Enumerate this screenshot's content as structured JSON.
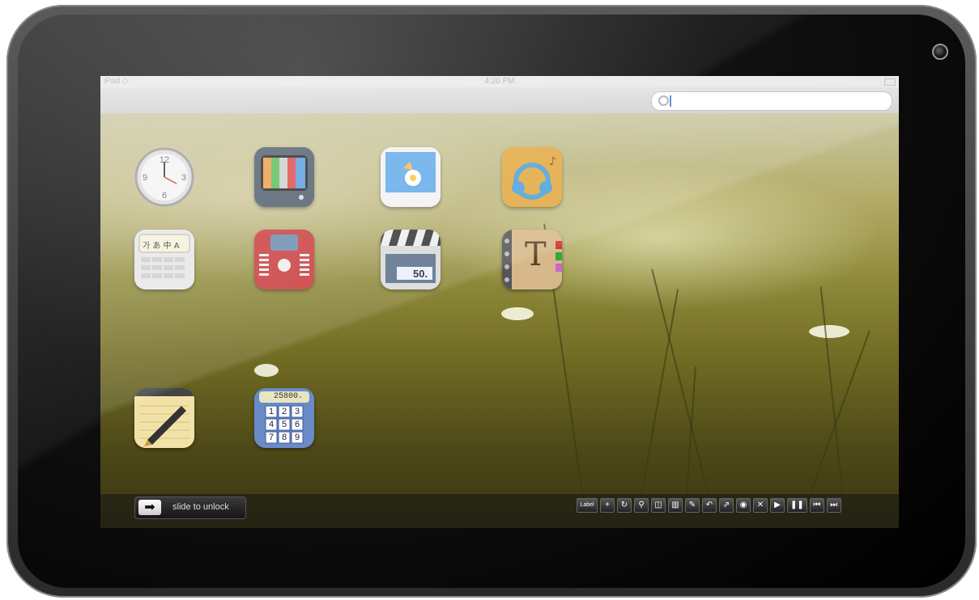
{
  "status": {
    "left": "iPad ◇",
    "time": "4:20 PM"
  },
  "search": {
    "placeholder": ""
  },
  "apps": [
    {
      "name": "clock"
    },
    {
      "name": "tv"
    },
    {
      "name": "photos"
    },
    {
      "name": "music"
    },
    {
      "name": "dictionary"
    },
    {
      "name": "radio"
    },
    {
      "name": "video"
    },
    {
      "name": "text-book"
    },
    {
      "name": "notes"
    },
    {
      "name": "calculator",
      "display": "25800."
    }
  ],
  "dictionary_keys": "가 あ 中 A",
  "video_counter": "50.",
  "calculator_keys": [
    "1",
    "2",
    "3",
    "4",
    "5",
    "6",
    "7",
    "8",
    "9"
  ],
  "textbook_letter": "T",
  "unlock": {
    "arrow": "➡",
    "label": "slide to unlock"
  },
  "toolbar": [
    {
      "icon": "label",
      "glyph": "Label"
    },
    {
      "icon": "plus-icon",
      "glyph": "+"
    },
    {
      "icon": "refresh-icon",
      "glyph": "↻"
    },
    {
      "icon": "search-icon",
      "glyph": "⚲"
    },
    {
      "icon": "book-icon",
      "glyph": "◫"
    },
    {
      "icon": "trash-icon",
      "glyph": "▥"
    },
    {
      "icon": "edit-icon",
      "glyph": "✎"
    },
    {
      "icon": "back-icon",
      "glyph": "↶"
    },
    {
      "icon": "share-icon",
      "glyph": "⇗"
    },
    {
      "icon": "camera-icon",
      "glyph": "◉"
    },
    {
      "icon": "close-icon",
      "glyph": "✕"
    },
    {
      "icon": "play-icon",
      "glyph": "▶"
    },
    {
      "icon": "pause-icon",
      "glyph": "❚❚"
    },
    {
      "icon": "rewind-icon",
      "glyph": "⏮"
    },
    {
      "icon": "forward-icon",
      "glyph": "⏭"
    }
  ]
}
